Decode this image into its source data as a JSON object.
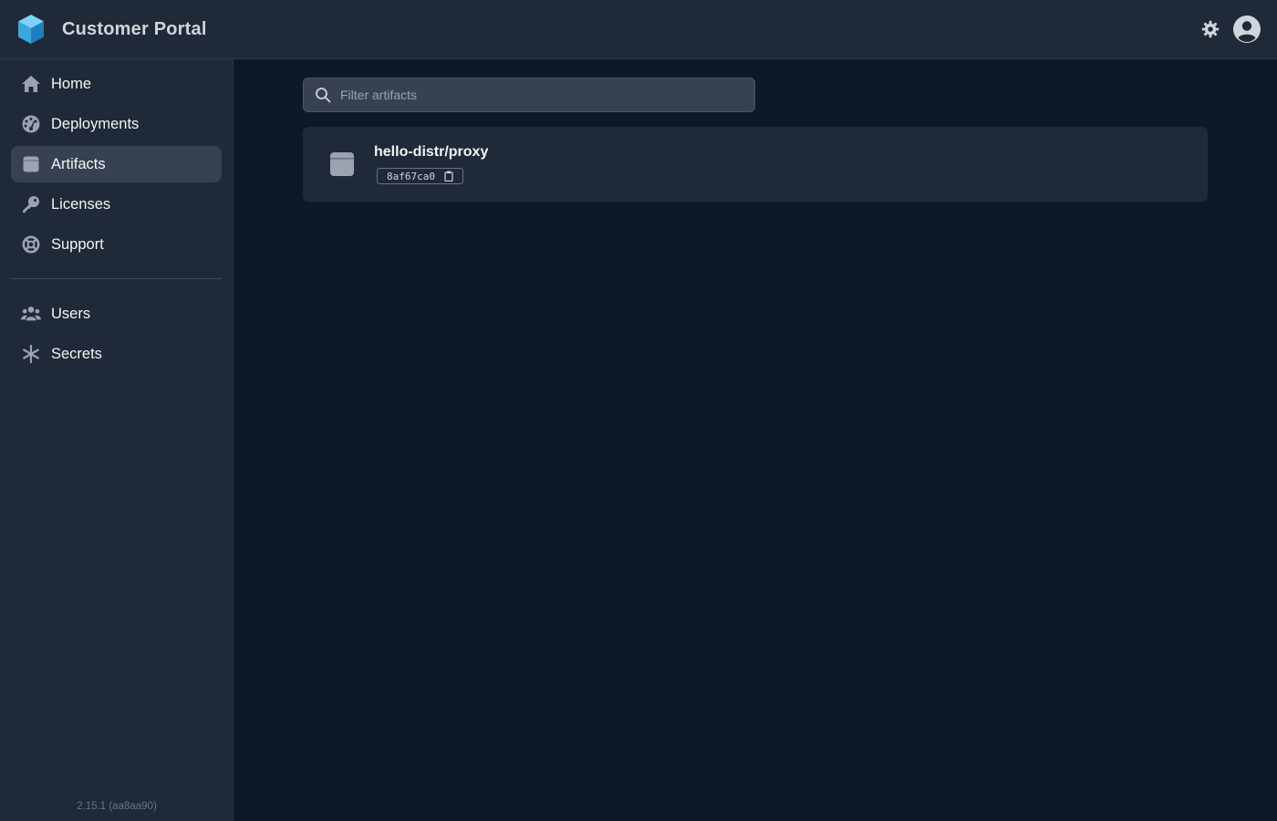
{
  "app": {
    "title": "Customer Portal",
    "version": "2.15.1 (aa8aa90)"
  },
  "header": {
    "theme_icon": "gear-icon",
    "account_icon": "user-circle-icon"
  },
  "sidebar": {
    "items": [
      {
        "label": "Home",
        "icon": "home-icon",
        "active": false
      },
      {
        "label": "Deployments",
        "icon": "dashboard-icon",
        "active": false
      },
      {
        "label": "Artifacts",
        "icon": "archive-box-icon",
        "active": true
      },
      {
        "label": "Licenses",
        "icon": "key-icon",
        "active": false
      },
      {
        "label": "Support",
        "icon": "lifebuoy-icon",
        "active": false
      }
    ],
    "admin_items": [
      {
        "label": "Users",
        "icon": "users-icon",
        "active": false
      },
      {
        "label": "Secrets",
        "icon": "asterisk-icon",
        "active": false
      }
    ]
  },
  "main": {
    "search": {
      "placeholder": "Filter artifacts",
      "value": ""
    },
    "artifacts": [
      {
        "name": "hello-distr/proxy",
        "digest": "8af67ca0",
        "icon": "archive-box-icon",
        "copy_icon": "clipboard-icon"
      }
    ]
  },
  "colors": {
    "background": "#0f1829",
    "panel": "#1f2937",
    "active": "#374151",
    "logo": "#4fb3e8"
  }
}
